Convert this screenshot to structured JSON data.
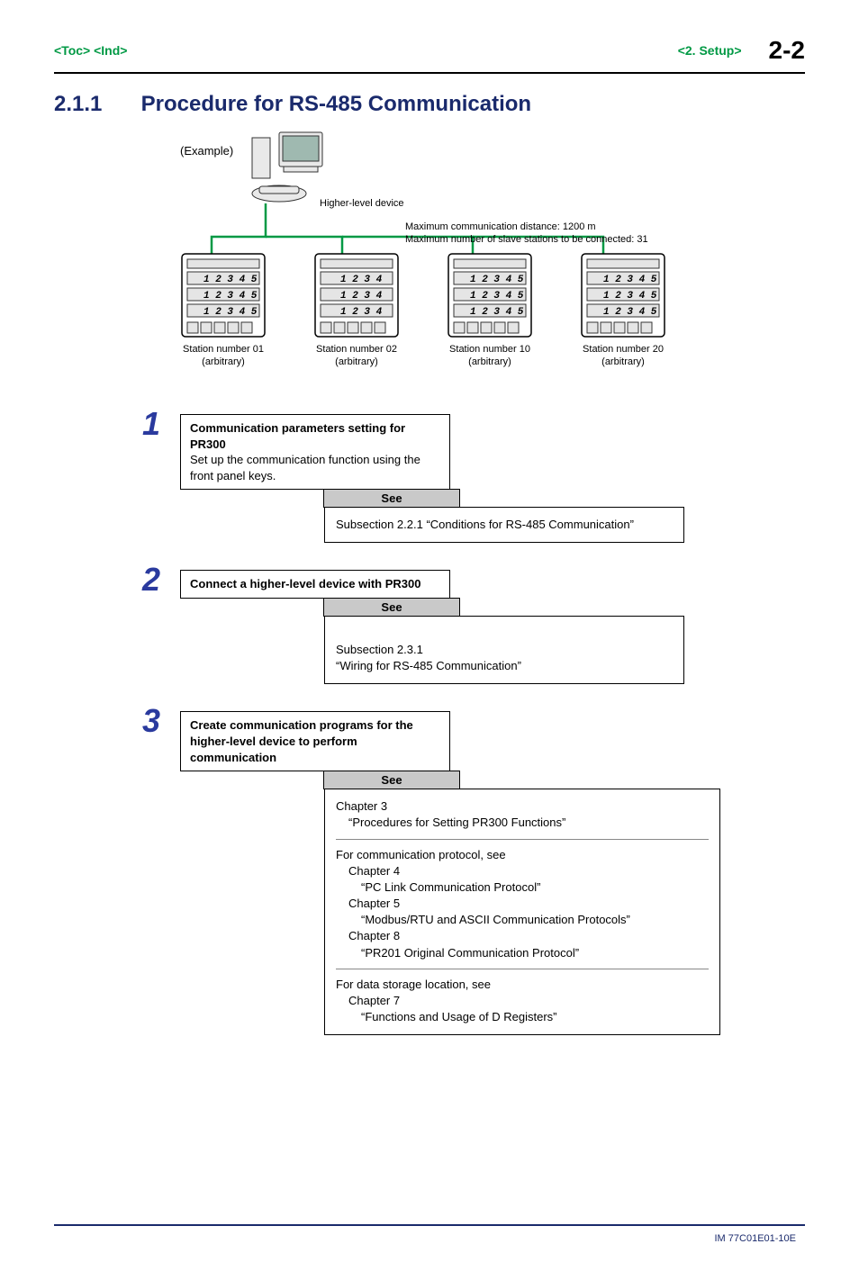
{
  "header": {
    "toc": "<Toc>",
    "ind": "<Ind>",
    "chapter_link": "<2.  Setup>",
    "page_num": "2-2"
  },
  "title": {
    "number": "2.1.1",
    "text": "Procedure for RS-485 Communication"
  },
  "diagram": {
    "example": "(Example)",
    "host_label": "Higher-level device",
    "spec1": "Maximum communication distance: 1200 m",
    "spec2": "Maximum number of slave stations to be connected: 31",
    "stations": [
      {
        "line1": "Station number 01",
        "line2": "(arbitrary)"
      },
      {
        "line1": "Station number 02",
        "line2": "(arbitrary)"
      },
      {
        "line1": "Station number 10",
        "line2": "(arbitrary)"
      },
      {
        "line1": "Station number 20",
        "line2": "(arbitrary)"
      }
    ]
  },
  "steps": [
    {
      "num": "1",
      "title": "Communication parameters setting for PR300",
      "body": "Set up the communication function using the front panel keys.",
      "see_tab": "See",
      "see_body_plain": "Subsection 2.2.1 “Conditions for RS-485 Communication”"
    },
    {
      "num": "2",
      "title": "Connect a higher-level device with PR300",
      "body": "",
      "see_tab": "See",
      "see_body_plain": "Subsection 2.3.1\n“Wiring for RS-485 Communication”"
    },
    {
      "num": "3",
      "title": "Create communication programs for the higher-level device to perform communication",
      "body": "",
      "see_tab": "See",
      "see_blocks": {
        "b1_l1": "Chapter 3",
        "b1_l2": "“Procedures for Setting PR300 Functions”",
        "b2_intro": "For communication protocol, see",
        "b2_c4": "Chapter 4",
        "b2_c4t": "“PC Link Communication Protocol”",
        "b2_c5": "Chapter 5",
        "b2_c5t": "“Modbus/RTU and ASCII Communication Protocols”",
        "b2_c8": "Chapter 8",
        "b2_c8t": "“PR201 Original Communication Protocol”",
        "b3_intro": "For data storage location, see",
        "b3_c7": "Chapter 7",
        "b3_c7t": "“Functions and Usage of D Registers”"
      }
    }
  ],
  "footer": {
    "code": "IM 77C01E01-10E"
  }
}
